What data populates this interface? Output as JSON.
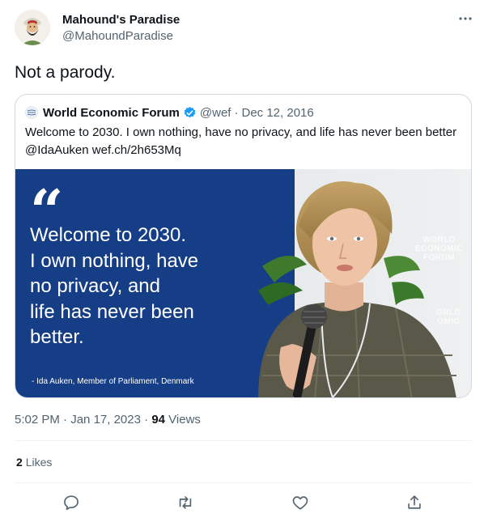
{
  "author": {
    "name": "Mahound's Paradise",
    "handle": "@MahoundParadise",
    "avatar": "bearded-man-turban-avatar"
  },
  "more_icon": "more-options-icon",
  "tweet_text": "Not a parody.",
  "quoted_tweet": {
    "logo": "world-economic-forum-logo",
    "name": "World Economic Forum",
    "verified": true,
    "handle": "@wef",
    "separator": "·",
    "date": "Dec 12, 2016",
    "text_line1": "Welcome to 2030. I own nothing, have no privacy, and life has never been better",
    "text_line2": "@IdaAuken wef.ch/2h653Mq",
    "image": {
      "quote_mark": "“",
      "quote_lines": [
        "Welcome to 2030.",
        "I own nothing, have",
        "no privacy, and",
        "life has never been",
        "better."
      ],
      "attribution": "- Ida Auken, Member of Parliament, Denmark",
      "watermark1": [
        "WORLD",
        "ECONOMIC",
        "FORUM"
      ],
      "watermark2": [
        "ORLD",
        "OMIC"
      ]
    }
  },
  "timestamp": {
    "time": "5:02 PM",
    "separator": "·",
    "date": "Jan 17, 2023",
    "views_separator": "·",
    "views_count": "94",
    "views_label": "Views"
  },
  "stats": {
    "likes_count": "2",
    "likes_label": "Likes"
  },
  "actions": [
    "reply-icon",
    "retweet-icon",
    "like-icon",
    "share-icon"
  ],
  "colors": {
    "primary_text": "#0f1419",
    "secondary_text": "#536471",
    "verified_blue": "#1d9bf0",
    "border": "#cfd9de",
    "image_blue": "#163e86"
  }
}
